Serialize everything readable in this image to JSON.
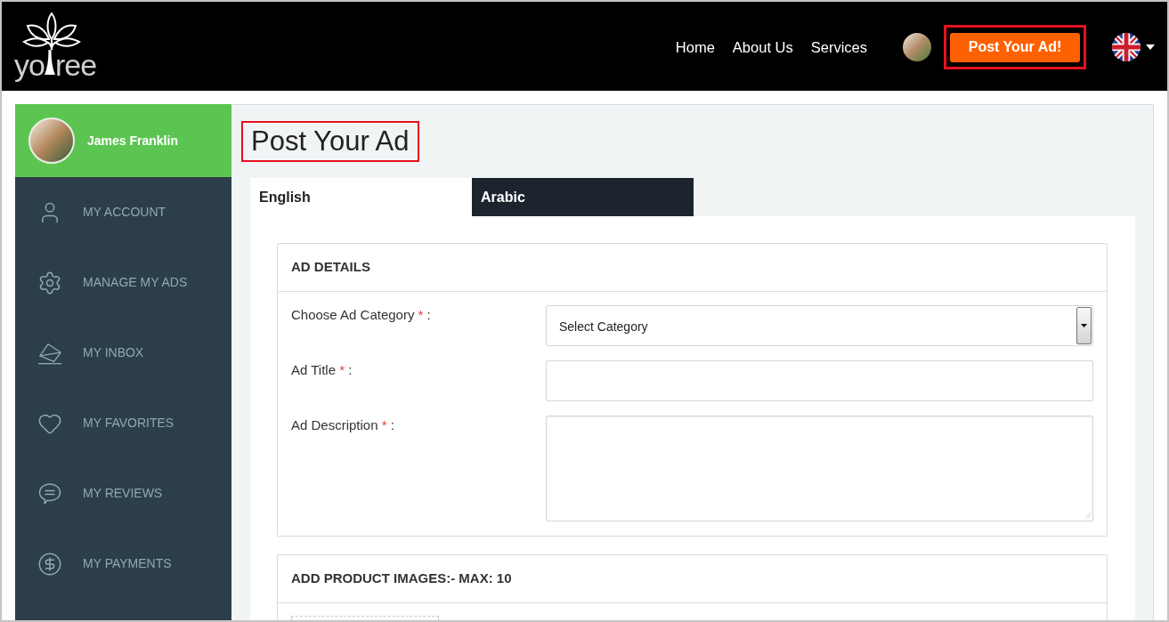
{
  "header": {
    "logo": {
      "text_start": "yo",
      "text_end": "ree"
    },
    "nav": [
      "Home",
      "About Us",
      "Services"
    ],
    "post_button": {
      "label": "Post Your Ad!",
      "highlighted": true
    }
  },
  "sidebar": {
    "user": {
      "name": "James Franklin"
    },
    "items": [
      "MY ACCOUNT",
      "MANAGE MY ADS",
      "MY INBOX",
      "MY FAVORITES",
      "MY REVIEWS",
      "MY PAYMENTS"
    ]
  },
  "main": {
    "title": {
      "text": "Post Your Ad",
      "highlighted": true
    },
    "tabs": [
      {
        "label": "English",
        "selected": true
      },
      {
        "label": "Arabic",
        "selected": false
      }
    ],
    "sections": [
      {
        "heading": "AD DETAILS",
        "fields": [
          {
            "kind": "select",
            "label": "Choose Ad Category",
            "required_mark": "*",
            "suffix": ":",
            "value": "Select Category"
          },
          {
            "kind": "text",
            "label": "Ad Title",
            "required_mark": "*",
            "suffix": ":"
          },
          {
            "kind": "textarea",
            "label": "Ad Description",
            "required_mark": "*",
            "suffix": ":"
          }
        ]
      },
      {
        "heading": "ADD PRODUCT IMAGES:- MAX: 10",
        "fields": [
          {
            "kind": "upload"
          }
        ]
      }
    ]
  }
}
